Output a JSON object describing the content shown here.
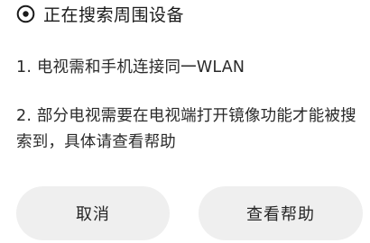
{
  "status": {
    "icon": "searching-indicator-icon",
    "text": "正在搜索周围设备"
  },
  "tips": [
    {
      "text": "1. 电视需和手机连接同一WLAN"
    },
    {
      "text": "2. 部分电视需要在电视端打开镜像功能才能被搜索到，具体请查看帮助"
    }
  ],
  "buttons": {
    "cancel_label": "取消",
    "help_label": "查看帮助"
  },
  "colors": {
    "background": "#ffffff",
    "button_bg": "#efefef",
    "text": "#1a1a1a"
  }
}
